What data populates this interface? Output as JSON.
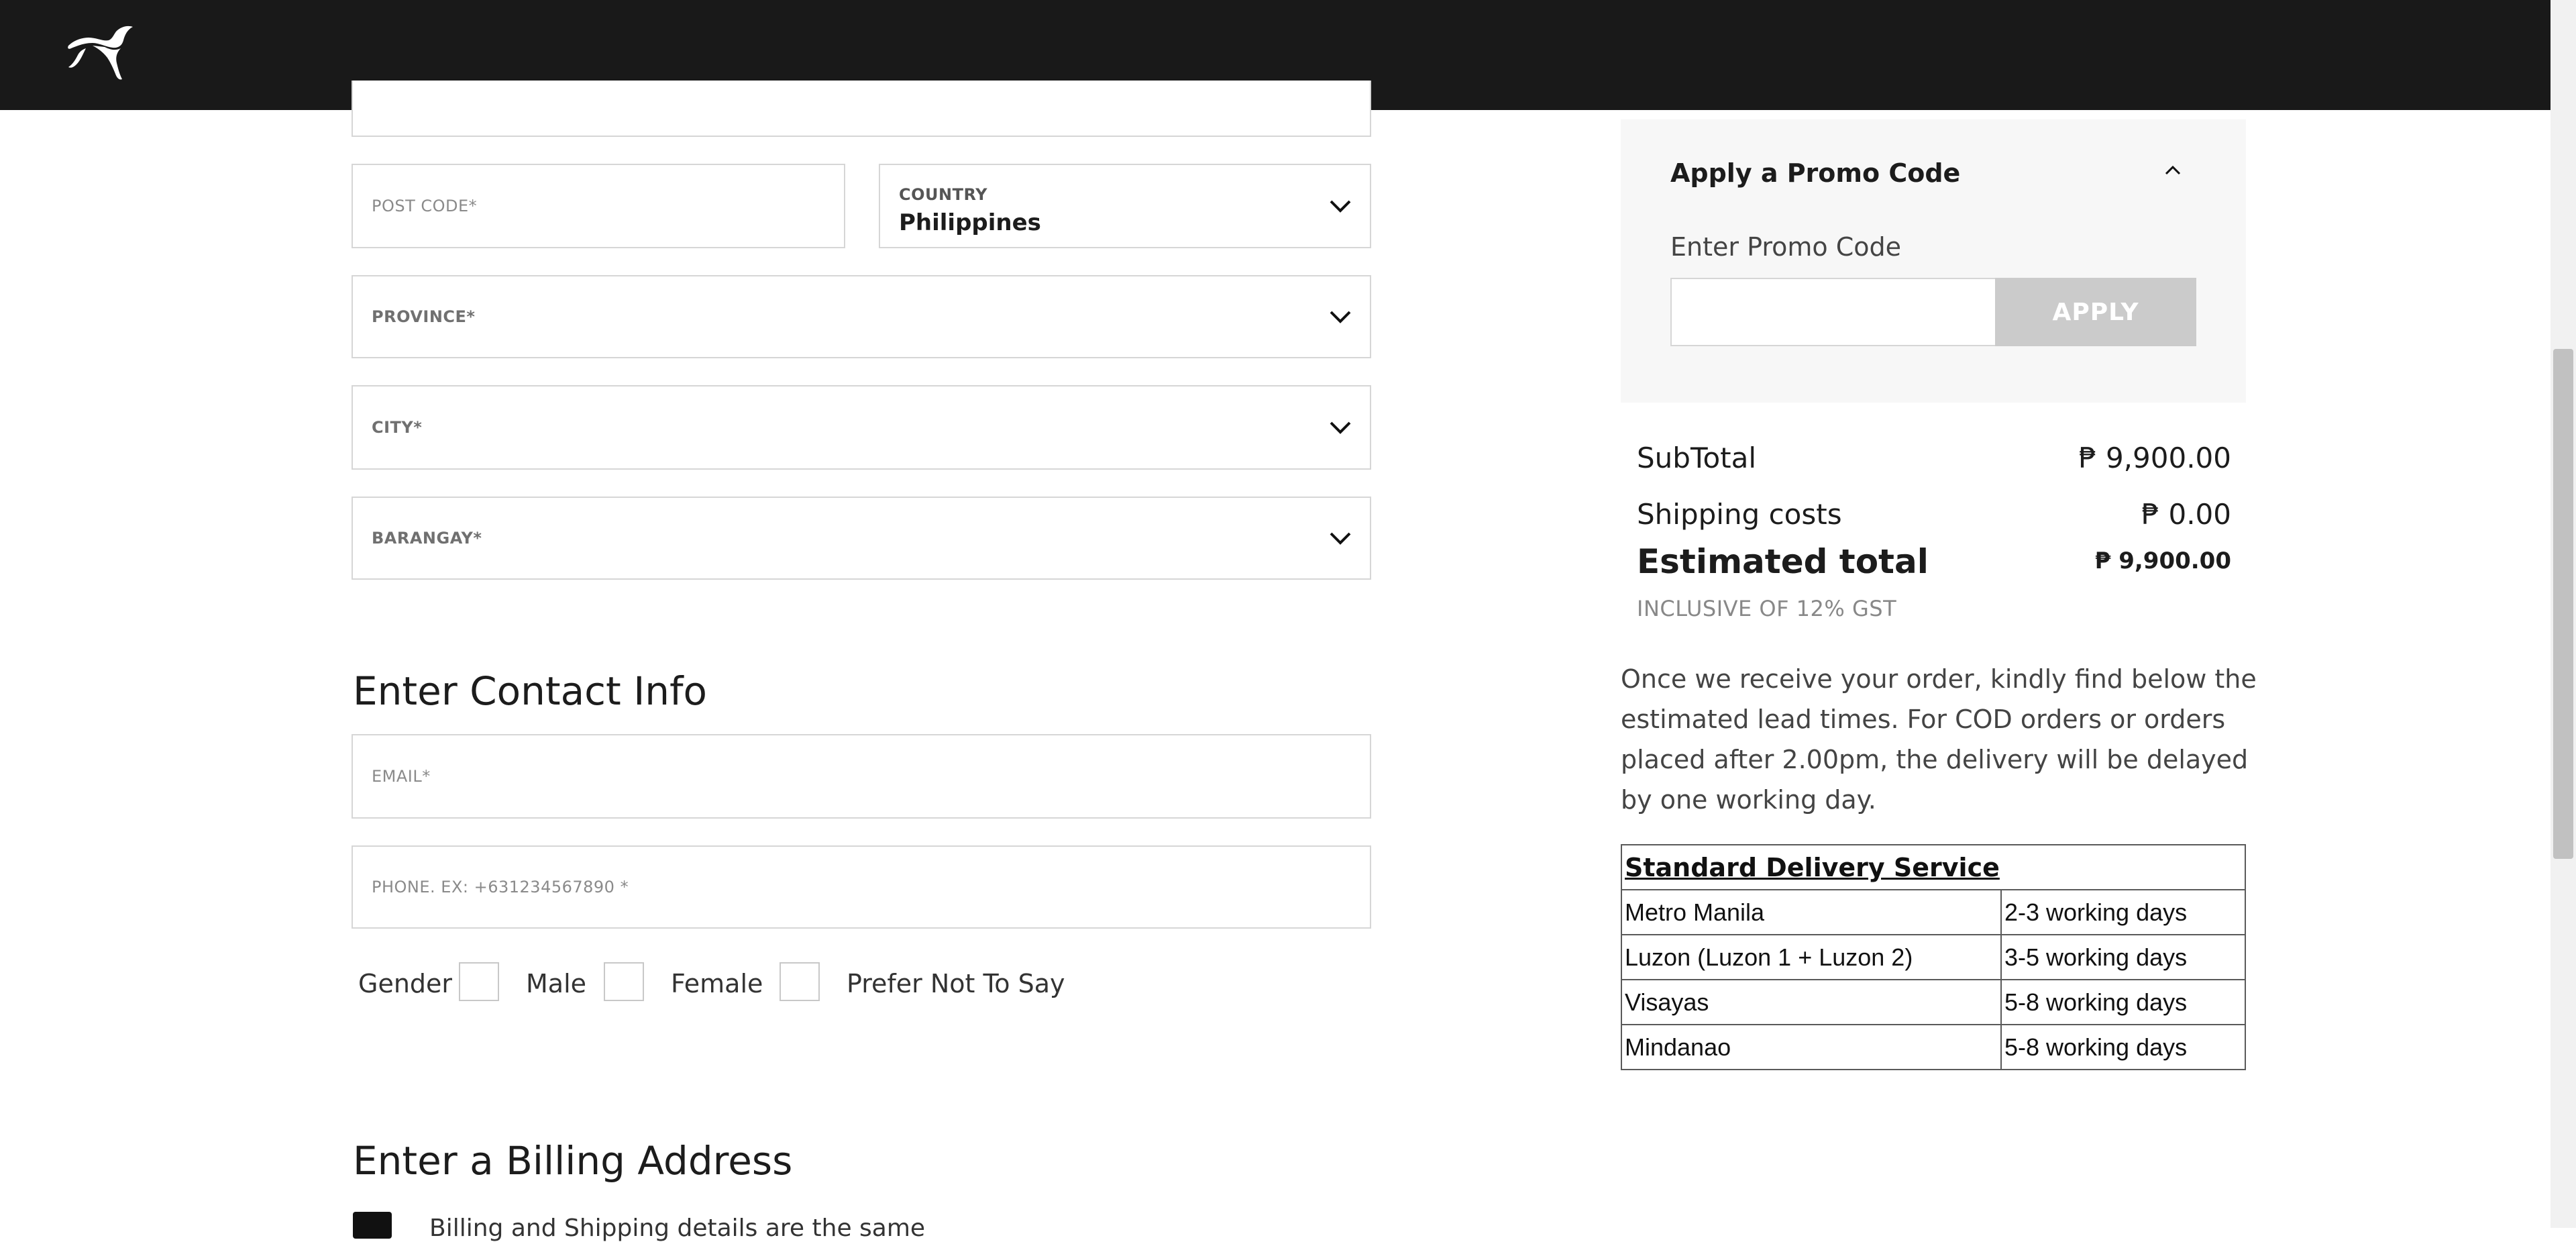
{
  "header": {
    "logo": "puma-logo-icon"
  },
  "shipping_form": {
    "post_code": {
      "placeholder": "POST CODE*"
    },
    "country": {
      "label": "COUNTRY",
      "value": "Philippines"
    },
    "province": {
      "placeholder": "PROVINCE*"
    },
    "city": {
      "placeholder": "CITY*"
    },
    "barangay": {
      "placeholder": "BARANGAY*"
    }
  },
  "contact": {
    "title": "Enter Contact Info",
    "email": {
      "placeholder": "EMAIL*"
    },
    "phone": {
      "placeholder": "PHONE. EX: +631234567890 *"
    },
    "gender_label": "Gender",
    "gender_options": [
      "Male",
      "Female",
      "Prefer Not To Say"
    ]
  },
  "billing": {
    "title": "Enter a Billing Address",
    "checkbox_text": "Billing and Shipping details are the same"
  },
  "promo": {
    "title": "Apply a Promo Code",
    "label": "Enter Promo Code",
    "input_value": "",
    "button": "APPLY"
  },
  "summary": {
    "subtotal_label": "SubTotal",
    "subtotal_value": "₱ 9,900.00",
    "shipping_label": "Shipping costs",
    "shipping_value": "₱ 0.00",
    "total_label": "Estimated total",
    "total_value": "₱ 9,900.00",
    "tax_note": "INCLUSIVE OF 12% GST"
  },
  "lead_time_text": "Once we receive your order, kindly find below the estimated lead times. For COD orders or orders placed after 2.00pm, the delivery will be delayed by one working day.",
  "delivery_table": {
    "title": "Standard Delivery Service",
    "rows": [
      {
        "region": "Metro Manila",
        "days": "2-3 working days"
      },
      {
        "region": "Luzon (Luzon 1 + Luzon 2)",
        "days": "3-5 working days"
      },
      {
        "region": "Visayas",
        "days": "5-8 working days"
      },
      {
        "region": "Mindanao",
        "days": "5-8 working days"
      }
    ]
  }
}
